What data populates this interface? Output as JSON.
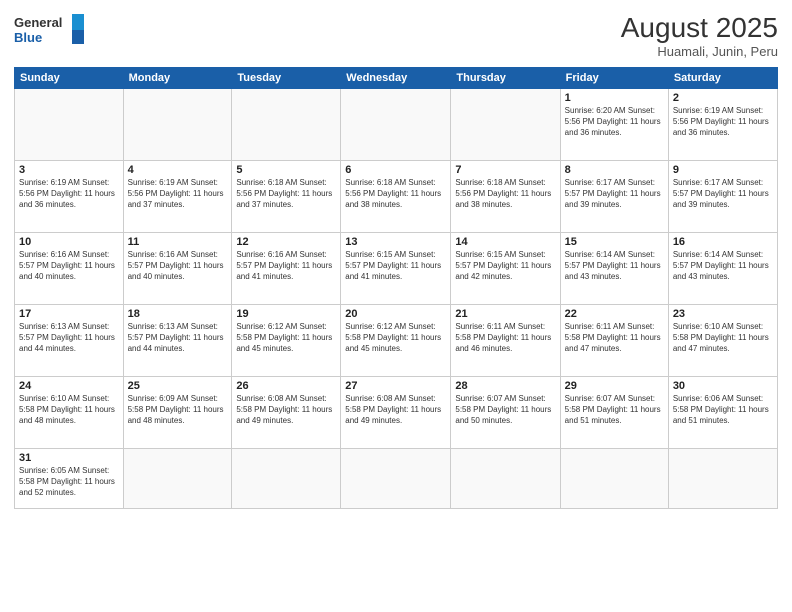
{
  "header": {
    "logo_general": "General",
    "logo_blue": "Blue",
    "month_year": "August 2025",
    "location": "Huamali, Junin, Peru"
  },
  "weekdays": [
    "Sunday",
    "Monday",
    "Tuesday",
    "Wednesday",
    "Thursday",
    "Friday",
    "Saturday"
  ],
  "weeks": [
    [
      {
        "day": "",
        "info": ""
      },
      {
        "day": "",
        "info": ""
      },
      {
        "day": "",
        "info": ""
      },
      {
        "day": "",
        "info": ""
      },
      {
        "day": "",
        "info": ""
      },
      {
        "day": "1",
        "info": "Sunrise: 6:20 AM\nSunset: 5:56 PM\nDaylight: 11 hours and 36 minutes."
      },
      {
        "day": "2",
        "info": "Sunrise: 6:19 AM\nSunset: 5:56 PM\nDaylight: 11 hours and 36 minutes."
      }
    ],
    [
      {
        "day": "3",
        "info": "Sunrise: 6:19 AM\nSunset: 5:56 PM\nDaylight: 11 hours and 36 minutes."
      },
      {
        "day": "4",
        "info": "Sunrise: 6:19 AM\nSunset: 5:56 PM\nDaylight: 11 hours and 37 minutes."
      },
      {
        "day": "5",
        "info": "Sunrise: 6:18 AM\nSunset: 5:56 PM\nDaylight: 11 hours and 37 minutes."
      },
      {
        "day": "6",
        "info": "Sunrise: 6:18 AM\nSunset: 5:56 PM\nDaylight: 11 hours and 38 minutes."
      },
      {
        "day": "7",
        "info": "Sunrise: 6:18 AM\nSunset: 5:56 PM\nDaylight: 11 hours and 38 minutes."
      },
      {
        "day": "8",
        "info": "Sunrise: 6:17 AM\nSunset: 5:57 PM\nDaylight: 11 hours and 39 minutes."
      },
      {
        "day": "9",
        "info": "Sunrise: 6:17 AM\nSunset: 5:57 PM\nDaylight: 11 hours and 39 minutes."
      }
    ],
    [
      {
        "day": "10",
        "info": "Sunrise: 6:16 AM\nSunset: 5:57 PM\nDaylight: 11 hours and 40 minutes."
      },
      {
        "day": "11",
        "info": "Sunrise: 6:16 AM\nSunset: 5:57 PM\nDaylight: 11 hours and 40 minutes."
      },
      {
        "day": "12",
        "info": "Sunrise: 6:16 AM\nSunset: 5:57 PM\nDaylight: 11 hours and 41 minutes."
      },
      {
        "day": "13",
        "info": "Sunrise: 6:15 AM\nSunset: 5:57 PM\nDaylight: 11 hours and 41 minutes."
      },
      {
        "day": "14",
        "info": "Sunrise: 6:15 AM\nSunset: 5:57 PM\nDaylight: 11 hours and 42 minutes."
      },
      {
        "day": "15",
        "info": "Sunrise: 6:14 AM\nSunset: 5:57 PM\nDaylight: 11 hours and 43 minutes."
      },
      {
        "day": "16",
        "info": "Sunrise: 6:14 AM\nSunset: 5:57 PM\nDaylight: 11 hours and 43 minutes."
      }
    ],
    [
      {
        "day": "17",
        "info": "Sunrise: 6:13 AM\nSunset: 5:57 PM\nDaylight: 11 hours and 44 minutes."
      },
      {
        "day": "18",
        "info": "Sunrise: 6:13 AM\nSunset: 5:57 PM\nDaylight: 11 hours and 44 minutes."
      },
      {
        "day": "19",
        "info": "Sunrise: 6:12 AM\nSunset: 5:58 PM\nDaylight: 11 hours and 45 minutes."
      },
      {
        "day": "20",
        "info": "Sunrise: 6:12 AM\nSunset: 5:58 PM\nDaylight: 11 hours and 45 minutes."
      },
      {
        "day": "21",
        "info": "Sunrise: 6:11 AM\nSunset: 5:58 PM\nDaylight: 11 hours and 46 minutes."
      },
      {
        "day": "22",
        "info": "Sunrise: 6:11 AM\nSunset: 5:58 PM\nDaylight: 11 hours and 47 minutes."
      },
      {
        "day": "23",
        "info": "Sunrise: 6:10 AM\nSunset: 5:58 PM\nDaylight: 11 hours and 47 minutes."
      }
    ],
    [
      {
        "day": "24",
        "info": "Sunrise: 6:10 AM\nSunset: 5:58 PM\nDaylight: 11 hours and 48 minutes."
      },
      {
        "day": "25",
        "info": "Sunrise: 6:09 AM\nSunset: 5:58 PM\nDaylight: 11 hours and 48 minutes."
      },
      {
        "day": "26",
        "info": "Sunrise: 6:08 AM\nSunset: 5:58 PM\nDaylight: 11 hours and 49 minutes."
      },
      {
        "day": "27",
        "info": "Sunrise: 6:08 AM\nSunset: 5:58 PM\nDaylight: 11 hours and 49 minutes."
      },
      {
        "day": "28",
        "info": "Sunrise: 6:07 AM\nSunset: 5:58 PM\nDaylight: 11 hours and 50 minutes."
      },
      {
        "day": "29",
        "info": "Sunrise: 6:07 AM\nSunset: 5:58 PM\nDaylight: 11 hours and 51 minutes."
      },
      {
        "day": "30",
        "info": "Sunrise: 6:06 AM\nSunset: 5:58 PM\nDaylight: 11 hours and 51 minutes."
      }
    ],
    [
      {
        "day": "31",
        "info": "Sunrise: 6:05 AM\nSunset: 5:58 PM\nDaylight: 11 hours and 52 minutes."
      },
      {
        "day": "",
        "info": ""
      },
      {
        "day": "",
        "info": ""
      },
      {
        "day": "",
        "info": ""
      },
      {
        "day": "",
        "info": ""
      },
      {
        "day": "",
        "info": ""
      },
      {
        "day": "",
        "info": ""
      }
    ]
  ]
}
